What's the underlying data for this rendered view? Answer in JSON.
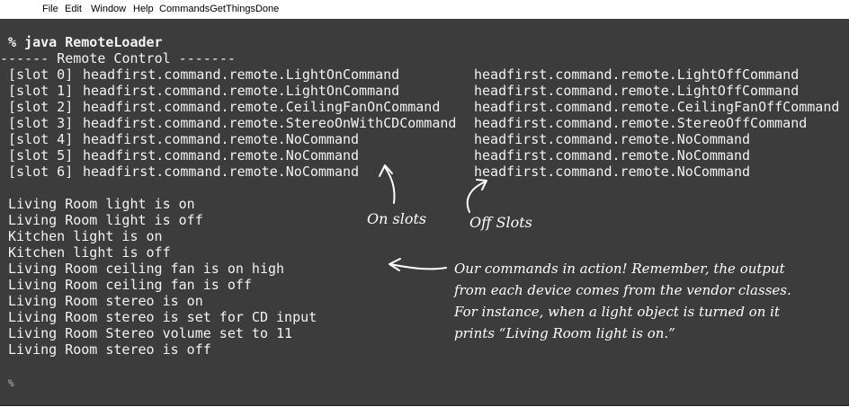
{
  "menu": {
    "items": [
      "File",
      "Edit",
      "Window",
      "Help",
      "CommandsGetThingsDone"
    ]
  },
  "terminal": {
    "command": "% java RemoteLoader",
    "header": "------ Remote Control -------",
    "slots": [
      {
        "label": "[slot 0]",
        "on": "headfirst.command.remote.LightOnCommand",
        "off": "headfirst.command.remote.LightOffCommand"
      },
      {
        "label": "[slot 1]",
        "on": "headfirst.command.remote.LightOnCommand",
        "off": "headfirst.command.remote.LightOffCommand"
      },
      {
        "label": "[slot 2]",
        "on": "headfirst.command.remote.CeilingFanOnCommand",
        "off": "headfirst.command.remote.CeilingFanOffCommand"
      },
      {
        "label": "[slot 3]",
        "on": "headfirst.command.remote.StereoOnWithCDCommand",
        "off": "headfirst.command.remote.StereoOffCommand"
      },
      {
        "label": "[slot 4]",
        "on": "headfirst.command.remote.NoCommand",
        "off": "headfirst.command.remote.NoCommand"
      },
      {
        "label": "[slot 5]",
        "on": "headfirst.command.remote.NoCommand",
        "off": "headfirst.command.remote.NoCommand"
      },
      {
        "label": "[slot 6]",
        "on": "headfirst.command.remote.NoCommand",
        "off": "headfirst.command.remote.NoCommand"
      }
    ],
    "output": [
      "Living Room light is on",
      "Living Room light is off",
      "Kitchen light is on",
      "Kitchen light is off",
      "Living Room ceiling fan is on high",
      "Living Room ceiling fan is off",
      "Living Room stereo is on",
      "Living Room stereo is set for CD input",
      "Living Room Stereo volume set to 11",
      "Living Room stereo is off"
    ],
    "prompt": "%"
  },
  "annotations": {
    "on_slots": "On slots",
    "off_slots": "Off Slots",
    "commands_note": [
      "Our commands in action!  Remember, the output",
      "from each device comes from the vendor classes.",
      "For instance, when a light object is turned on it",
      "prints “Living Room light is on.”"
    ]
  }
}
